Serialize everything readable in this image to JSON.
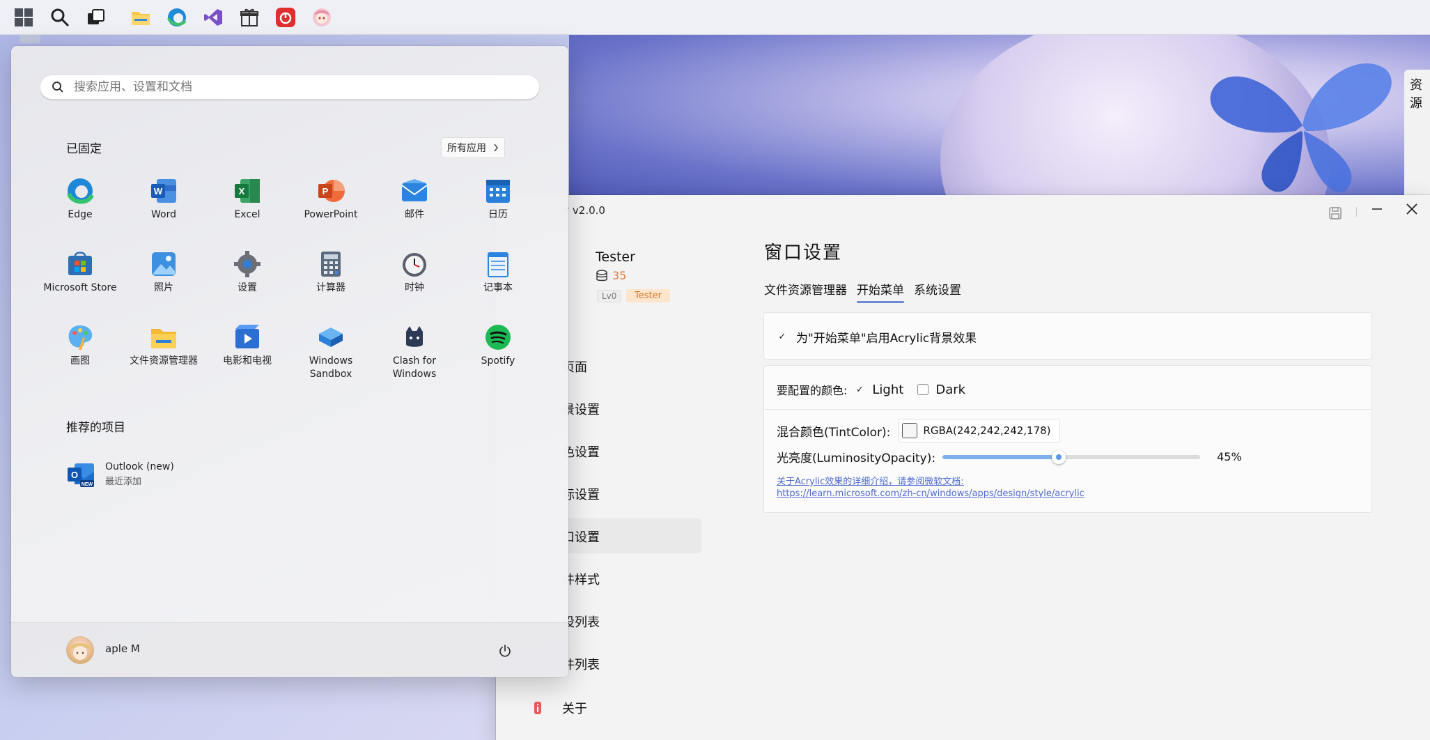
{
  "taskbar": {
    "icons": [
      "windows-start-icon",
      "search-icon",
      "task-view-icon",
      "file-explorer-icon",
      "edge-icon",
      "visual-studio-icon",
      "gift-icon",
      "netease-music-icon",
      "anime-avatar-icon"
    ]
  },
  "app_window": {
    "title": "ส v2.0.0",
    "user": {
      "name": "Tester",
      "coins": "35",
      "level": "Lv0",
      "role": "Tester"
    },
    "nav": [
      {
        "label": "页面"
      },
      {
        "label": "景设置"
      },
      {
        "label": "色设置"
      },
      {
        "label": "标设置"
      },
      {
        "label": "口设置"
      },
      {
        "label": "件样式"
      },
      {
        "label": "设列表"
      },
      {
        "label": "件列表"
      },
      {
        "label": "关于"
      }
    ],
    "heading": "窗口设置",
    "tabs": [
      "文件资源管理器",
      "开始菜单",
      "系统设置"
    ],
    "active_tab": 1,
    "acrylic_toggle_label": "为\"开始菜单\"启用Acrylic背景效果",
    "acrylic_enabled": true,
    "color_config_label": "要配置的颜色:",
    "light_label": "Light",
    "light_checked": true,
    "dark_label": "Dark",
    "dark_checked": false,
    "tint_label": "混合颜色(TintColor):",
    "tint_value": "RGBA(242,242,242,178)",
    "luminosity_label": "光亮度(LuminosityOpacity):",
    "luminosity_value": "45%",
    "luminosity_fraction": 0.45,
    "note_line1": "关于Acrylic效果的详细介绍，请参阅微软文档:",
    "note_line2": "https://learn.microsoft.com/zh-cn/windows/apps/design/style/acrylic",
    "accent_color": "#6a8ad4"
  },
  "start_menu": {
    "search_placeholder": "搜索应用、设置和文档",
    "pinned_title": "已固定",
    "all_apps_label": "所有应用",
    "pinned_apps": [
      {
        "label": "Edge",
        "icon": "edge-icon"
      },
      {
        "label": "Word",
        "icon": "word-icon"
      },
      {
        "label": "Excel",
        "icon": "excel-icon"
      },
      {
        "label": "PowerPoint",
        "icon": "powerpoint-icon"
      },
      {
        "label": "邮件",
        "icon": "mail-icon"
      },
      {
        "label": "日历",
        "icon": "calendar-icon"
      },
      {
        "label": "Microsoft Store",
        "icon": "store-icon"
      },
      {
        "label": "照片",
        "icon": "photos-icon"
      },
      {
        "label": "设置",
        "icon": "settings-icon"
      },
      {
        "label": "计算器",
        "icon": "calculator-icon"
      },
      {
        "label": "时钟",
        "icon": "clock-icon"
      },
      {
        "label": "记事本",
        "icon": "notepad-icon"
      },
      {
        "label": "画图",
        "icon": "paint-icon"
      },
      {
        "label": "文件资源管理器",
        "icon": "folder-icon"
      },
      {
        "label": "电影和电视",
        "icon": "movies-icon"
      },
      {
        "label": "Windows Sandbox",
        "icon": "sandbox-icon"
      },
      {
        "label": "Clash for Windows",
        "icon": "clash-icon"
      },
      {
        "label": "Spotify",
        "icon": "spotify-icon"
      }
    ],
    "recommended_title": "推荐的项目",
    "recommended": [
      {
        "title": "Outlook (new)",
        "subtitle": "最近添加",
        "icon": "outlook-icon"
      }
    ],
    "user_name": "aple M"
  },
  "right_panel": {
    "label": "资源"
  }
}
